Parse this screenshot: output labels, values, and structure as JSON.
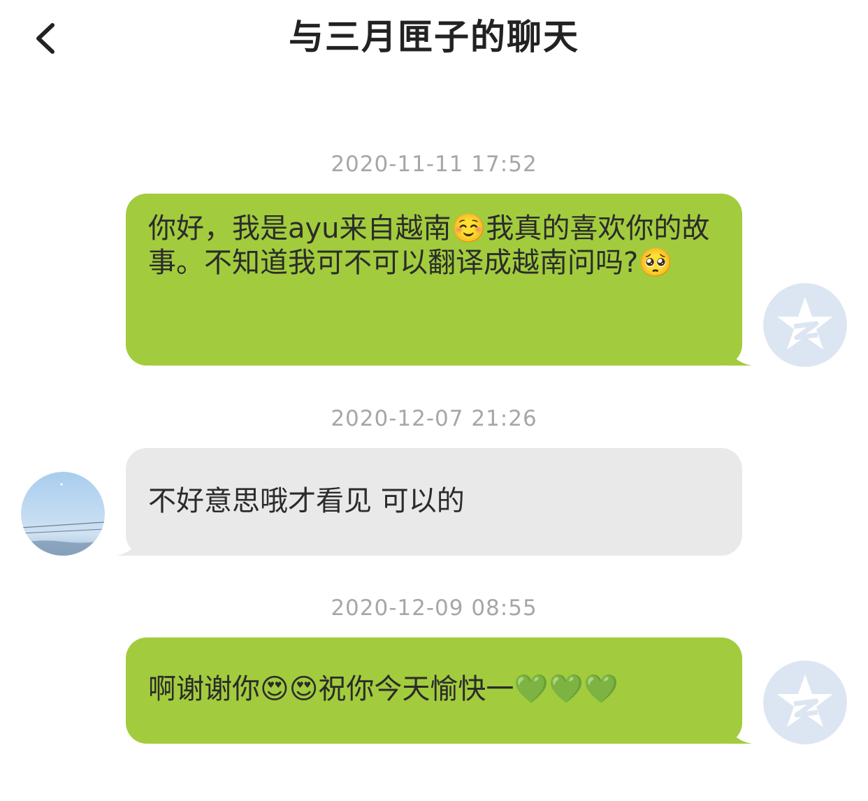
{
  "header": {
    "title": "与三月匣子的聊天",
    "back_icon": "chevron-left-icon"
  },
  "colors": {
    "sent_bubble": "#a2cc3d",
    "received_bubble": "#e9e9e9",
    "timestamp": "#a6a6a6",
    "self_avatar": "#dce6f3"
  },
  "messages": [
    {
      "timestamp": "2020-11-11 17:52",
      "direction": "sent",
      "text": "你好，我是ayu来自越南☺️我真的喜欢你的故事。不知道我可不可以翻译成越南问吗?🥺"
    },
    {
      "timestamp": "2020-12-07 21:26",
      "direction": "received",
      "text": "不好意思哦才看见 可以的"
    },
    {
      "timestamp": "2020-12-09 08:55",
      "direction": "sent",
      "text": "啊谢谢你😍😍祝你今天愉快一💚💚💚"
    }
  ]
}
